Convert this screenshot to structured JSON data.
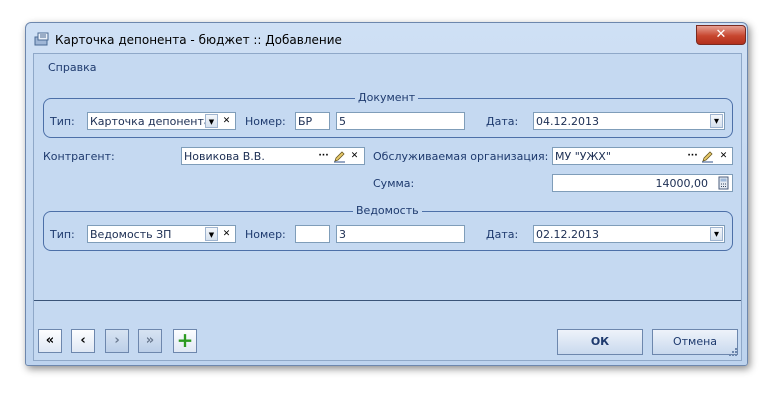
{
  "window": {
    "title": "Карточка депонента - бюджет :: Добавление",
    "close_glyph": "✕"
  },
  "menu": {
    "help": "Справка"
  },
  "document": {
    "legend": "Документ",
    "type_label": "Тип:",
    "type_value": "Карточка депонента",
    "number_label": "Номер:",
    "number_prefix": "БР",
    "number_value": "5",
    "date_label": "Дата:",
    "date_value": "04.12.2013"
  },
  "counterparty": {
    "label": "Контрагент:",
    "value": "Новикова В.В."
  },
  "organization": {
    "label": "Обслуживаемая организация:",
    "value": "МУ \"УЖХ\""
  },
  "amount": {
    "label": "Сумма:",
    "value": "14000,00"
  },
  "statement": {
    "legend": "Ведомость",
    "type_label": "Тип:",
    "type_value": "Ведомость ЗП",
    "number_label": "Номер:",
    "number_prefix": "",
    "number_value": "3",
    "date_label": "Дата:",
    "date_value": "02.12.2013"
  },
  "navigation": {
    "first": "«",
    "prev": "‹",
    "next": "›",
    "last": "»",
    "add": "+"
  },
  "buttons": {
    "ok": "ОК",
    "cancel": "Отмена"
  },
  "glyphs": {
    "dropdown": "▼",
    "clear": "✕",
    "ellipsis": "···",
    "date_dropdown": "▾"
  },
  "colors": {
    "client_bg": "#c5d9f1",
    "frame": "#4d70a8",
    "close_red": "#c7462f",
    "add_green": "#2c9a21"
  }
}
